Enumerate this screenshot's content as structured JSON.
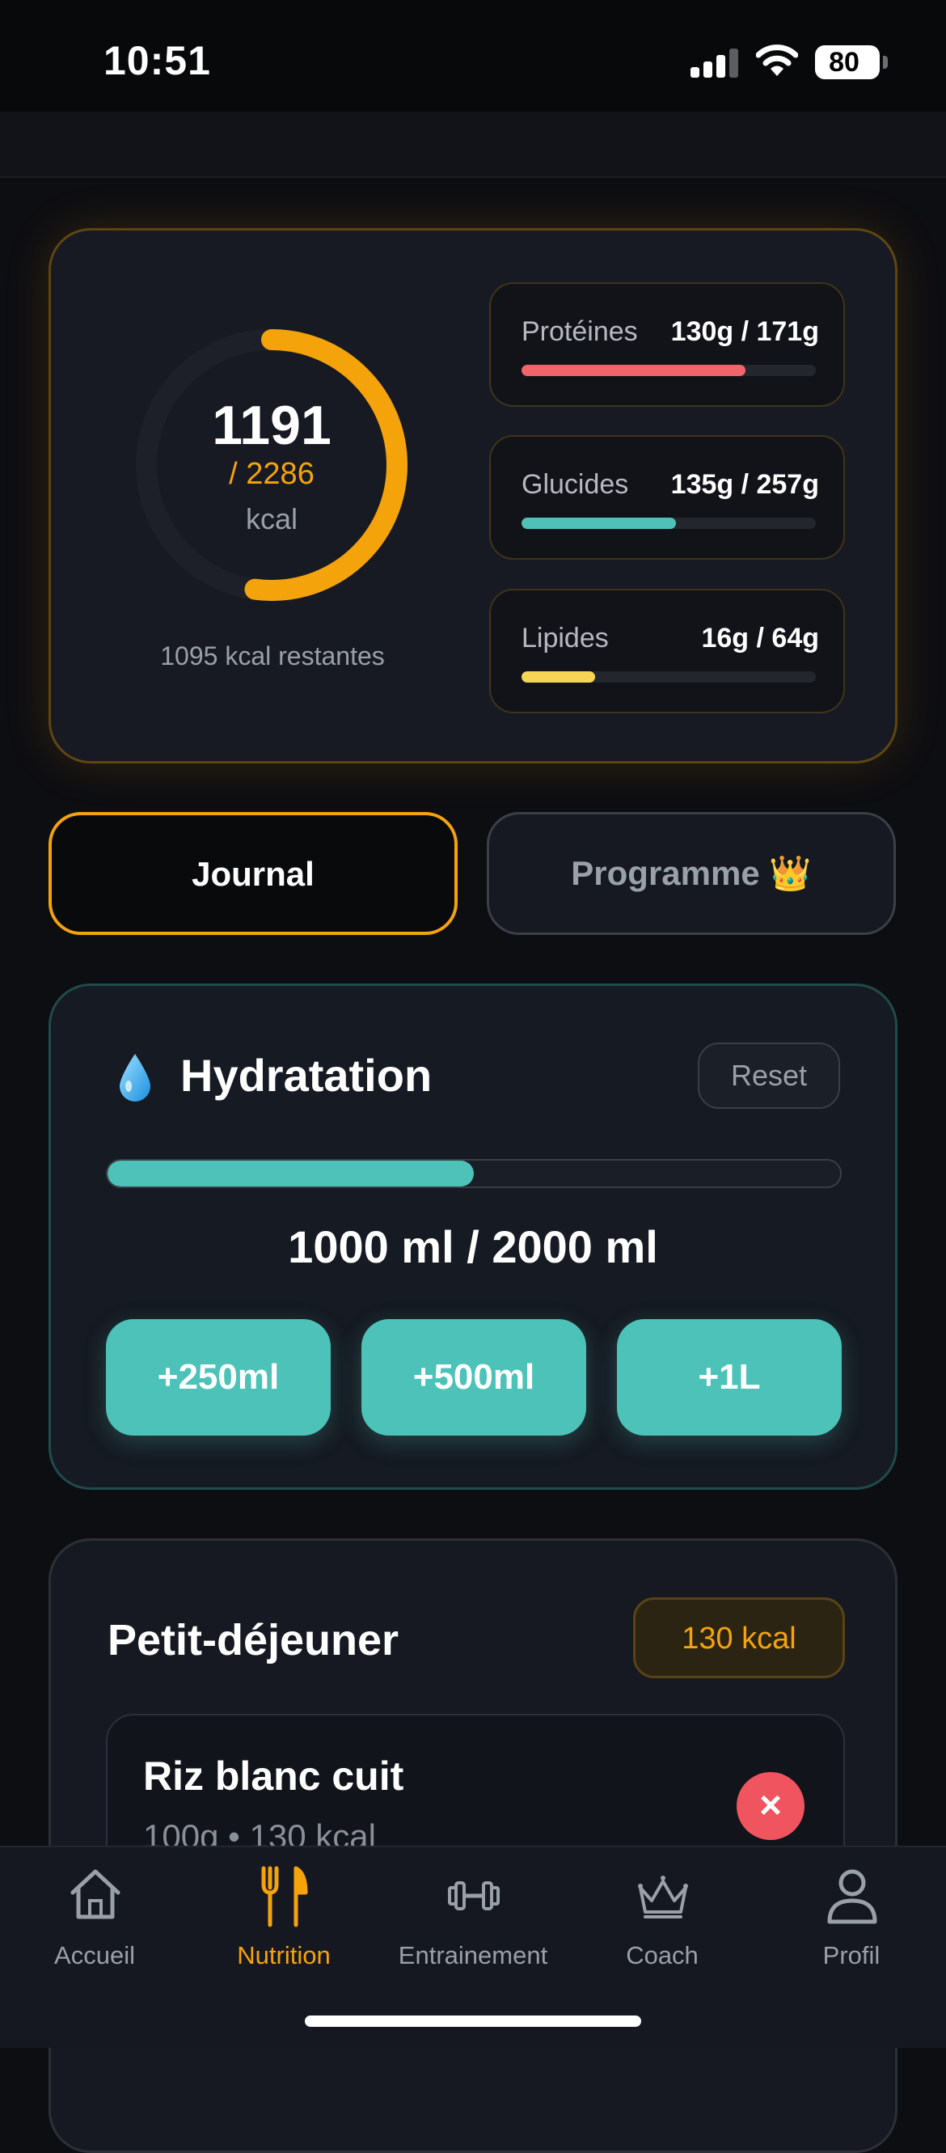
{
  "status_bar": {
    "time": "10:51",
    "battery": "80"
  },
  "summary": {
    "calories_consumed": "1191",
    "calories_goal": "/ 2286",
    "calories_unit": "kcal",
    "calories_progress": 0.521,
    "remaining": "1095 kcal restantes",
    "macros": [
      {
        "name": "Protéines",
        "value": "130g / 171g",
        "progress": 0.76,
        "color": "#f0646a"
      },
      {
        "name": "Glucides",
        "value": "135g / 257g",
        "progress": 0.525,
        "color": "#4ec2b9"
      },
      {
        "name": "Lipides",
        "value": "16g / 64g",
        "progress": 0.25,
        "color": "#f7d554"
      }
    ]
  },
  "tabs": [
    {
      "label": "Journal",
      "active": true
    },
    {
      "label": "Programme 👑",
      "active": false
    }
  ],
  "hydration": {
    "title": "Hydratation",
    "reset_label": "Reset",
    "progress": 0.5,
    "amount": "1000 ml / 2000 ml",
    "buttons": [
      "+250ml",
      "+500ml",
      "+1L"
    ]
  },
  "meal": {
    "title": "Petit-déjeuner",
    "badge": "130 kcal",
    "items": [
      {
        "name": "Riz blanc cuit",
        "detail": "100g • 130 kcal",
        "delete_label": "×"
      }
    ]
  },
  "nav": {
    "items": [
      {
        "label": "Accueil",
        "icon": "home-icon",
        "active": false
      },
      {
        "label": "Nutrition",
        "icon": "utensils-icon",
        "active": true
      },
      {
        "label": "Entrainement",
        "icon": "dumbbell-icon",
        "active": false
      },
      {
        "label": "Coach",
        "icon": "crown-icon",
        "active": false
      },
      {
        "label": "Profil",
        "icon": "user-icon",
        "active": false
      }
    ]
  },
  "colors": {
    "accent": "#f5a30b",
    "teal": "#4ec2b9",
    "danger": "#f0545e",
    "background": "#0d0e12"
  }
}
